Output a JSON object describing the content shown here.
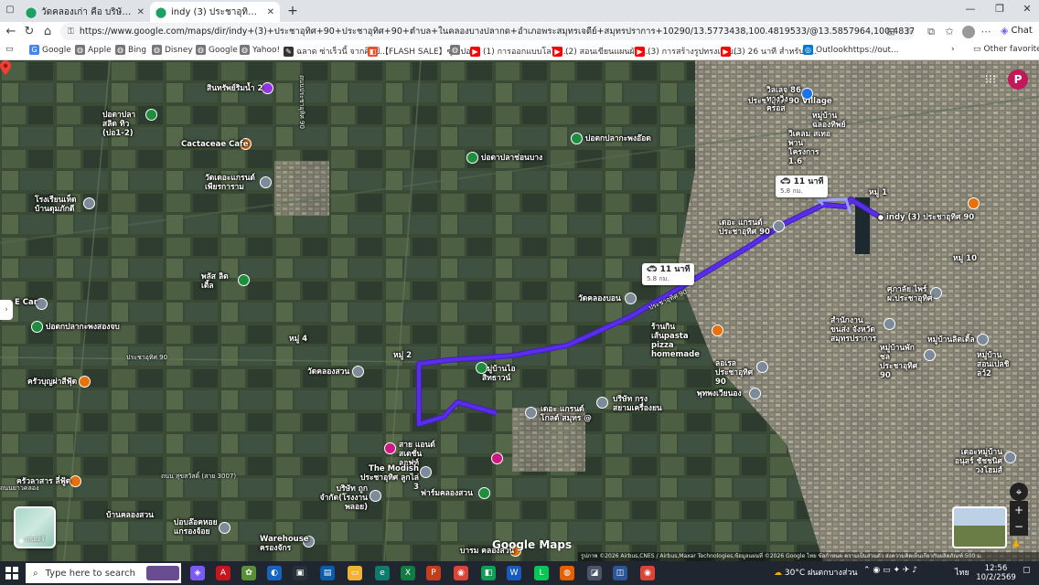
{
  "browser": {
    "tabs": [
      {
        "title": "วัดคลองเก่า คือ บริษัท บางกอกยูนิฟอร์ม ฯ",
        "active": false
      },
      {
        "title": "indy (3) ประชาอุทิศ 90 ถึง หอพัก มีแม่",
        "active": true
      }
    ],
    "new_tab": "+",
    "window_controls": [
      "—",
      "❐",
      "✕"
    ],
    "url": "https://www.google.com/maps/dir/indy+(3)+ประชาอุทิศ+90+ประชาอุทิศ+90+ตำบล+ในคลองบางปลากด+อำเภอพระสมุทรเจดีย์+สมุทรปราการ+10290/13.5773438,100.4819533/@13.5857964,100.483755,4277m/data=!3m2!1e3!4b1!4m8!4m7!1m5!1m1!1",
    "chat_label": "Chat",
    "bookmarks": [
      {
        "label": "Google",
        "icon": "G",
        "color": "#4285f4"
      },
      {
        "label": "Apple",
        "icon": "◍",
        "color": "#777777"
      },
      {
        "label": "Bing",
        "icon": "◍",
        "color": "#777777"
      },
      {
        "label": "Disney",
        "icon": "◍",
        "color": "#777777"
      },
      {
        "label": "Google",
        "icon": "◍",
        "color": "#777777"
      },
      {
        "label": "Yahoo!",
        "icon": "◍",
        "color": "#777777"
      },
      {
        "label": "ฉลาด ซ่าเร็วนี้ จากศิลป์...",
        "icon": "✎",
        "color": "#333333"
      },
      {
        "label": "【FLASH SALE】ซุปเปอ...",
        "icon": "◧",
        "color": "#ee4d2d"
      },
      {
        "label": "",
        "icon": "◍",
        "color": "#777777"
      },
      {
        "label": "(1) การออกแบบโลโก้...",
        "icon": "▶",
        "color": "#ff0000"
      },
      {
        "label": "(2) สอนเขียนแผนผังไ...",
        "icon": "▶",
        "color": "#ff0000"
      },
      {
        "label": "(3) การสร้างรูปทรงแบบ...",
        "icon": "▶",
        "color": "#ff0000"
      },
      {
        "label": "(3) 26 นาที สำหรับศั...",
        "icon": "▶",
        "color": "#ff0000"
      },
      {
        "label": "Outlookhttps://out...",
        "icon": "◎",
        "color": "#0078d4"
      }
    ],
    "other_favorites": "Other favorites"
  },
  "map": {
    "route_color": "#5b2de8",
    "origin_label": "indy (3) ประชาอุทิศ 90",
    "duration_boxes": [
      {
        "time": "11 นาที",
        "distance": "5.8 กม."
      },
      {
        "time": "11 นาที",
        "distance": "5.8 กม."
      }
    ],
    "places": [
      {
        "name": "สินทรัพย์ริมน้ำ 2",
        "color": "purple"
      },
      {
        "name": "ปอดาปลาสลิด ทิว (บ่อ1-2)",
        "color": "green"
      },
      {
        "name": "Cactaceae Cafe",
        "color": "orange"
      },
      {
        "name": "วัดเดอะแกรนด์ เพียรการาม",
        "color": "gray"
      },
      {
        "name": "โรงเรียนเห็ด บ้านดุมภักดี",
        "color": "gray"
      },
      {
        "name": "บ่อดาปลาช่อนบาง",
        "color": "green"
      },
      {
        "name": "บ่อตกปลากะพงอ๊อด",
        "color": "green"
      },
      {
        "name": "E Car",
        "color": "gray"
      },
      {
        "name": "บ่อตกปลากะพงสองจบ",
        "color": "green"
      },
      {
        "name": "พลัส ลิตเติ้ล",
        "color": "green"
      },
      {
        "name": "ครัวบุญผ่าสีฟุ้ด",
        "color": "orange"
      },
      {
        "name": "ครัวลาสาร ลี่ฟู้ด",
        "color": "orange"
      },
      {
        "name": "วัดคลองสวน",
        "color": "gray"
      },
      {
        "name": "หมู่บ้านไอ สิทธาวน์",
        "color": "gray"
      },
      {
        "name": "วัดคลองบอน",
        "color": "gray"
      },
      {
        "name": "ร้านกินเส้นpasta pizza homemade",
        "color": "orange"
      },
      {
        "name": "ลอเรล ประชาอุทิศ 90",
        "color": "gray"
      },
      {
        "name": "พุทพงเวียนอง",
        "color": "gray"
      },
      {
        "name": "บริษัท กรุง สยามเครื่องยน",
        "color": "gray"
      },
      {
        "name": "เดอะ แกรนด์ โกลด์ สมุทร @",
        "color": "gray"
      },
      {
        "name": "สาย แอนด์ สเตชั่น ลอฟท์",
        "color": "pink"
      },
      {
        "name": "The Modish ประชาอุทิศ ลูกไล่ 3",
        "color": "gray"
      },
      {
        "name": "ฟาร์มคลองสวน",
        "color": "green"
      },
      {
        "name": "บริษัท ถูก จำกัด(โรงงานพลอย)",
        "color": "gray"
      },
      {
        "name": "บ่อบล๊อคหอย แกรองจ้อย",
        "color": "gray"
      },
      {
        "name": "Warehouse ครองจักร",
        "color": "gray"
      },
      {
        "name": "บ้านคลองสวน",
        "color": "gray"
      },
      {
        "name": "บารม คลองสวน",
        "color": "orange"
      },
      {
        "name": "เดอะ แกรนด์ประชาอุทิศ 90",
        "color": "gray"
      },
      {
        "name": "ประชาอุทิศ 90 Village",
        "color": "gray"
      },
      {
        "name": "วิลเลจ 86 ทางวิ่ง ครอส",
        "color": "blue"
      },
      {
        "name": "หมู่บ้าน ฉลองทิพย์",
        "color": "gray"
      },
      {
        "name": "วิเคลม สเทอพาน โครงการ 1.6",
        "color": "gray"
      },
      {
        "name": "ศุภาลัย ไพร์ ผ.ประชาอุทิศ",
        "color": "gray"
      },
      {
        "name": "สำนักงานขนส่ง จังหวัดสมุทรปราการ",
        "color": "gray"
      },
      {
        "name": "หมู่บ้านพักชล ประชาอุทิศ 90",
        "color": "gray"
      },
      {
        "name": "หมู่บ้านลิตเติ้ล",
        "color": "gray"
      },
      {
        "name": "หมู่บ้าน สอนเปลชิลว์2",
        "color": "gray"
      },
      {
        "name": "เดอะหมู่บ้าน อนุสร์ ชัชชนิศ วงโฮมส์",
        "color": "gray"
      },
      {
        "name": "หมู่ 10",
        "color": "gray"
      }
    ],
    "area_labels": [
      "หมู่ 2",
      "หมู่ 4",
      "หมู่ 1"
    ],
    "road_labels": [
      "ประชาอุทิศ 90",
      "ประชาอุทิศ 90",
      "ถนน สุขสวัสดิ์ (สาย 3007)",
      "ถนนประชาอุทิศ 90",
      "ถนนยาวคลอง"
    ],
    "layers_label": "เลเยอร์",
    "watermark": "Google Maps",
    "attribution": "รูปภาพ ©2026 Airbus,CNES / Airbus,Maxar Technologies,ข้อมูลแผนที่ ©2026 Google   ไทย   ข้อกำหนด   ความเป็นส่วนตัว   ส่งความคิดเห็นเกี่ยวกับผลิตภัณฑ์   500 ม.",
    "controls": [
      "⌖",
      "+",
      "−"
    ],
    "avatar_letter": "P"
  },
  "taskbar": {
    "search_placeholder": "Type here to search",
    "weather": "30°C ฝนตกบางส่วน",
    "time": "12:56",
    "date": "10/2/2569",
    "lang": "ไทย"
  }
}
